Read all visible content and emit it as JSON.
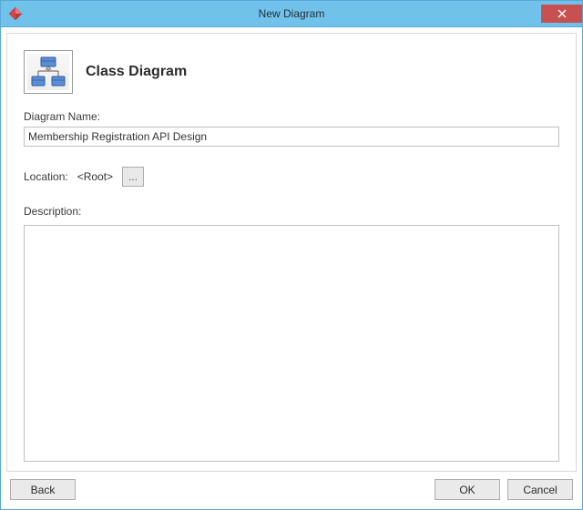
{
  "window": {
    "title": "New Diagram"
  },
  "header": {
    "heading": "Class Diagram"
  },
  "labels": {
    "diagram_name": "Diagram Name:",
    "location": "Location:",
    "description": "Description:"
  },
  "fields": {
    "diagram_name_value": "Membership Registration API Design",
    "location_value": "<Root>",
    "browse_label": "...",
    "description_value": ""
  },
  "buttons": {
    "back": "Back",
    "ok": "OK",
    "cancel": "Cancel"
  }
}
